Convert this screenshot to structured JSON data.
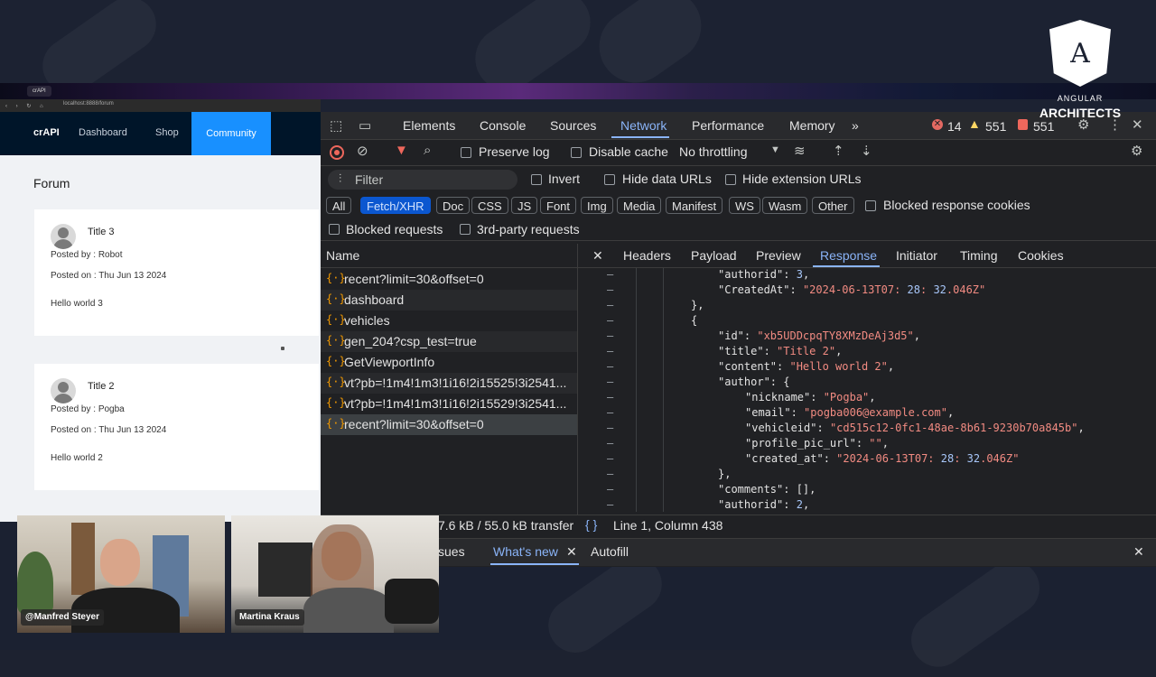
{
  "browser": {
    "tab_title": "crAPI",
    "url": "localhost:8888/forum"
  },
  "app": {
    "brand": "crAPI",
    "nav": [
      "Dashboard",
      "Shop",
      "Community"
    ],
    "forum_title": "Forum",
    "posts": [
      {
        "title": "Title 3",
        "posted_by_label": "Posted by :",
        "posted_by": "Robot",
        "posted_on_label": "Posted on :",
        "posted_on": "Thu Jun 13 2024",
        "body": "Hello world 3"
      },
      {
        "title": "Title 2",
        "posted_by_label": "Posted by :",
        "posted_by": "Pogba",
        "posted_on_label": "Posted on :",
        "posted_on": "Thu Jun 13 2024",
        "body": "Hello world 2"
      }
    ]
  },
  "devtools": {
    "tabs": [
      "Elements",
      "Console",
      "Sources",
      "Network",
      "Performance",
      "Memory"
    ],
    "active_tab": "Network",
    "more_tabs": "»",
    "error_count": "14",
    "warning_count": "551",
    "issue_count": "551",
    "toolbar": {
      "preserve_log": "Preserve log",
      "disable_cache": "Disable cache",
      "throttling": "No throttling"
    },
    "filter": {
      "placeholder": "Filter",
      "invert": "Invert",
      "hide_data_urls": "Hide data URLs",
      "hide_extension_urls": "Hide extension URLs"
    },
    "types": [
      "All",
      "Fetch/XHR",
      "Doc",
      "CSS",
      "JS",
      "Font",
      "Img",
      "Media",
      "Manifest",
      "WS",
      "Wasm",
      "Other"
    ],
    "active_type": "Fetch/XHR",
    "blocked_response_cookies": "Blocked response cookies",
    "blocked_requests": "Blocked requests",
    "third_party_requests": "3rd-party requests",
    "name_header": "Name",
    "requests": [
      "recent?limit=30&offset=0",
      "dashboard",
      "vehicles",
      "gen_204?csp_test=true",
      "GetViewportInfo",
      "vt?pb=!1m4!1m3!1i16!2i15525!3i2541...",
      "vt?pb=!1m4!1m3!1i16!2i15529!3i2541...",
      "recent?limit=30&offset=0"
    ],
    "detail_tabs": [
      "Headers",
      "Payload",
      "Preview",
      "Response",
      "Initiator",
      "Timing",
      "Cookies"
    ],
    "active_detail_tab": "Response",
    "response_lines": [
      {
        "indent": 1,
        "text": "\"authorid\": 3,"
      },
      {
        "indent": 1,
        "text": "\"CreatedAt\": \"2024-06-13T07:28:32.046Z\""
      },
      {
        "indent": 0,
        "text": "},"
      },
      {
        "indent": 0,
        "text": "{"
      },
      {
        "indent": 1,
        "text": "\"id\": \"xb5UDDcpqTY8XMzDeAj3d5\","
      },
      {
        "indent": 1,
        "text": "\"title\": \"Title 2\","
      },
      {
        "indent": 1,
        "text": "\"content\": \"Hello world 2\","
      },
      {
        "indent": 1,
        "text": "\"author\": {"
      },
      {
        "indent": 2,
        "text": "\"nickname\": \"Pogba\","
      },
      {
        "indent": 2,
        "text": "\"email\": \"pogba006@example.com\","
      },
      {
        "indent": 2,
        "text": "\"vehicleid\": \"cd515c12-0fc1-48ae-8b61-9230b70a845b\","
      },
      {
        "indent": 2,
        "text": "\"profile_pic_url\": \"\","
      },
      {
        "indent": 2,
        "text": "\"created_at\": \"2024-06-13T07:28:32.046Z\""
      },
      {
        "indent": 1,
        "text": "},"
      },
      {
        "indent": 1,
        "text": "\"comments\": [],"
      },
      {
        "indent": 1,
        "text": "\"authorid\": 2,"
      }
    ],
    "transfer_text": "7.6 kB / 55.0 kB transfer",
    "cursor_position": "Line 1, Column 438",
    "drawer_tabs": [
      "sues",
      "What's new",
      "Autofill"
    ],
    "active_drawer_tab": "What's new"
  },
  "logo": {
    "line1": "ANGULAR",
    "line2": "ARCHITECTS",
    "letter": "A"
  },
  "webcams": [
    {
      "name": "@Manfred Steyer"
    },
    {
      "name": "Martina Kraus"
    }
  ],
  "colors": {
    "accent_blue": "#1890ff",
    "devtools_accent": "#8ab4f8",
    "nav_bg": "#001529"
  }
}
